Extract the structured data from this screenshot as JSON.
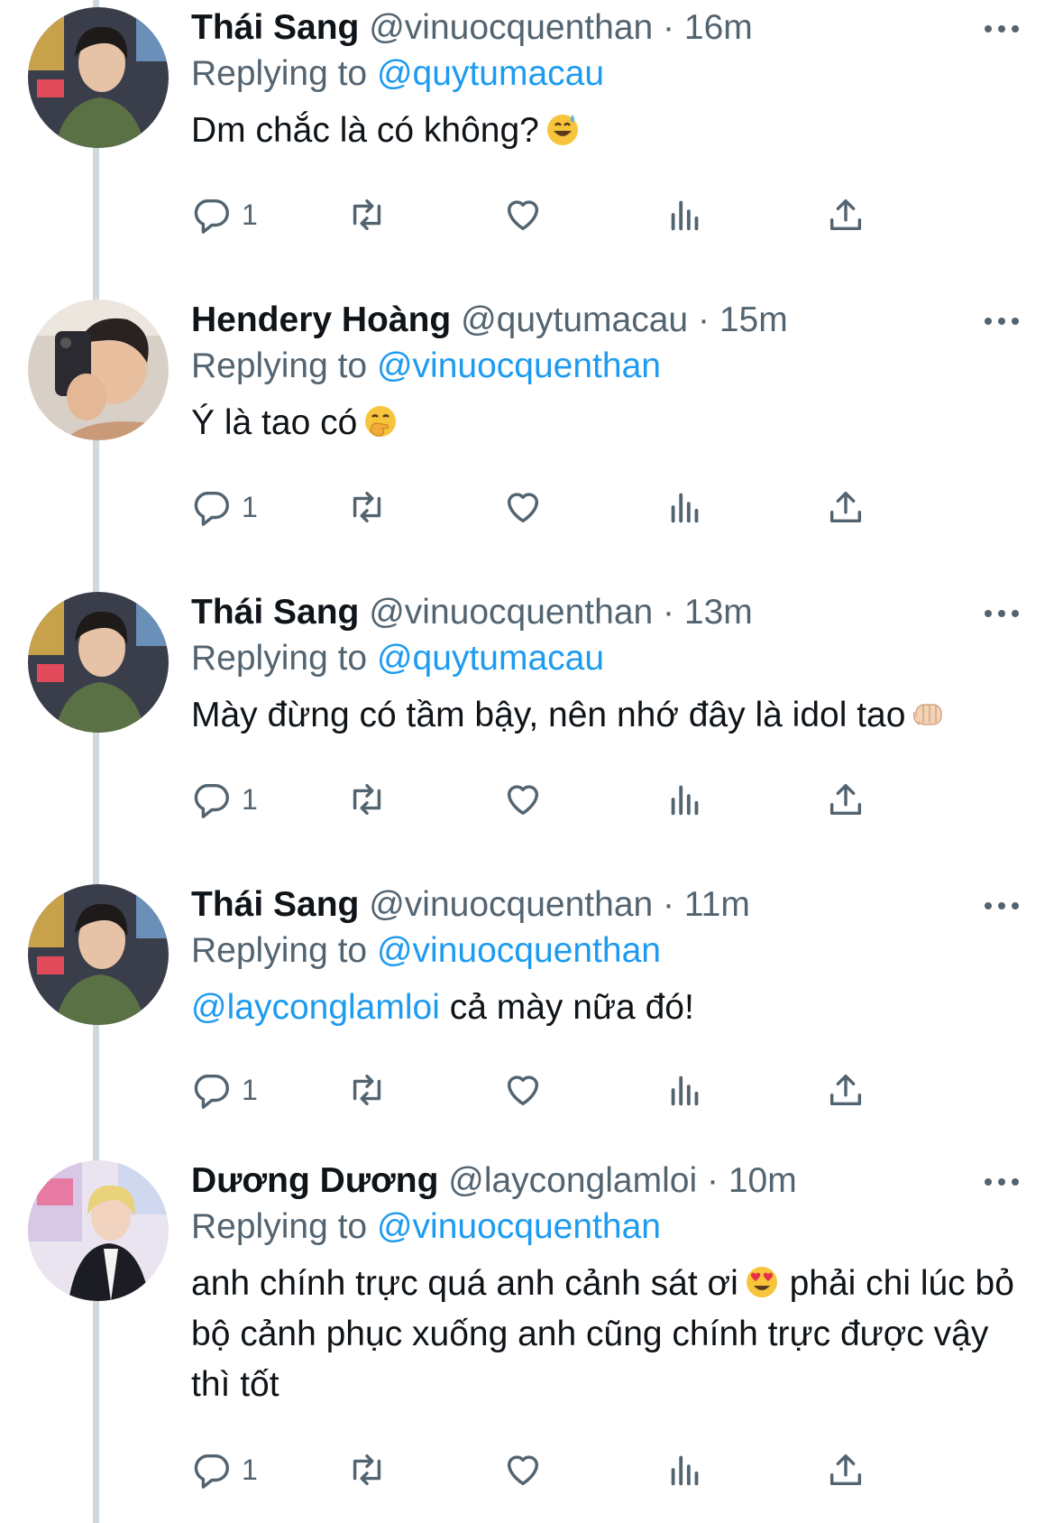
{
  "tweets": [
    {
      "name": "Thái Sang",
      "handle": "@vinuocquenthan",
      "time": "16m",
      "replying_label": "Replying to",
      "replying_to": "@quytumacau",
      "mention": "",
      "text": "Dm chắc là có không?",
      "emoji": "grinning-sweat-emoji",
      "text_after": "",
      "reply_count": "1",
      "avatar": "avatar-thai-sang"
    },
    {
      "name": "Hendery Hoàng",
      "handle": "@quytumacau",
      "time": "15m",
      "replying_label": "Replying to",
      "replying_to": "@vinuocquenthan",
      "mention": "",
      "text": "Ý là tao có",
      "emoji": "hand-over-mouth-emoji",
      "text_after": "",
      "reply_count": "1",
      "avatar": "avatar-hendery"
    },
    {
      "name": "Thái Sang",
      "handle": "@vinuocquenthan",
      "time": "13m",
      "replying_label": "Replying to",
      "replying_to": "@quytumacau",
      "mention": "",
      "text": "Mày đừng có tầm bậy, nên nhớ đây là idol tao",
      "emoji": "fist-bump-emoji",
      "text_after": "",
      "reply_count": "1",
      "avatar": "avatar-thai-sang"
    },
    {
      "name": "Thái Sang",
      "handle": "@vinuocquenthan",
      "time": "11m",
      "replying_label": "Replying to",
      "replying_to": "@vinuocquenthan",
      "mention": "@layconglamloi",
      "text": " cả mày nữa đó!",
      "emoji": "",
      "text_after": "",
      "reply_count": "1",
      "avatar": "avatar-thai-sang"
    },
    {
      "name": "Dương Dương",
      "handle": "@layconglamloi",
      "time": "10m",
      "replying_label": "Replying to",
      "replying_to": "@vinuocquenthan",
      "mention": "",
      "text": "anh chính trực quá anh cảnh sát ơi",
      "emoji": "heart-eyes-emoji",
      "text_after": " phải chi lúc bỏ bộ cảnh phục xuống anh cũng chính trực được vậy thì tốt",
      "reply_count": "1",
      "avatar": "avatar-duong-duong"
    }
  ],
  "separator": "·",
  "colors": {
    "link": "#1d9bf0",
    "muted": "#536471",
    "text": "#0f1419",
    "thread_line": "#cfd9de"
  }
}
